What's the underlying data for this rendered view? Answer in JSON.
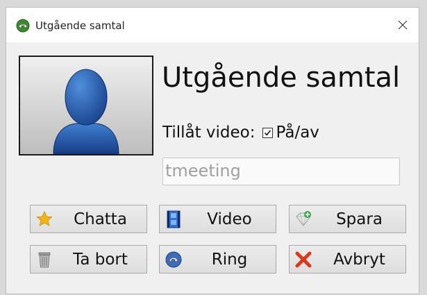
{
  "window": {
    "title": "Utgående samtal"
  },
  "call": {
    "heading": "Utgående samtal",
    "video_label": "Tillåt video:",
    "video_toggle_label": "På/av",
    "video_enabled": true,
    "address_value": "tmeeting"
  },
  "buttons": {
    "chat": "Chatta",
    "video": "Video",
    "save": "Spara",
    "delete": "Ta bort",
    "call": "Ring",
    "cancel": "Avbryt"
  },
  "icons": {
    "app": "phone-globe-icon",
    "close": "close-icon",
    "avatar": "user-silhouette-icon",
    "chat": "star-icon",
    "video": "film-icon",
    "save": "gem-add-icon",
    "delete": "trash-icon",
    "call": "phone-icon",
    "cancel": "cross-icon"
  }
}
